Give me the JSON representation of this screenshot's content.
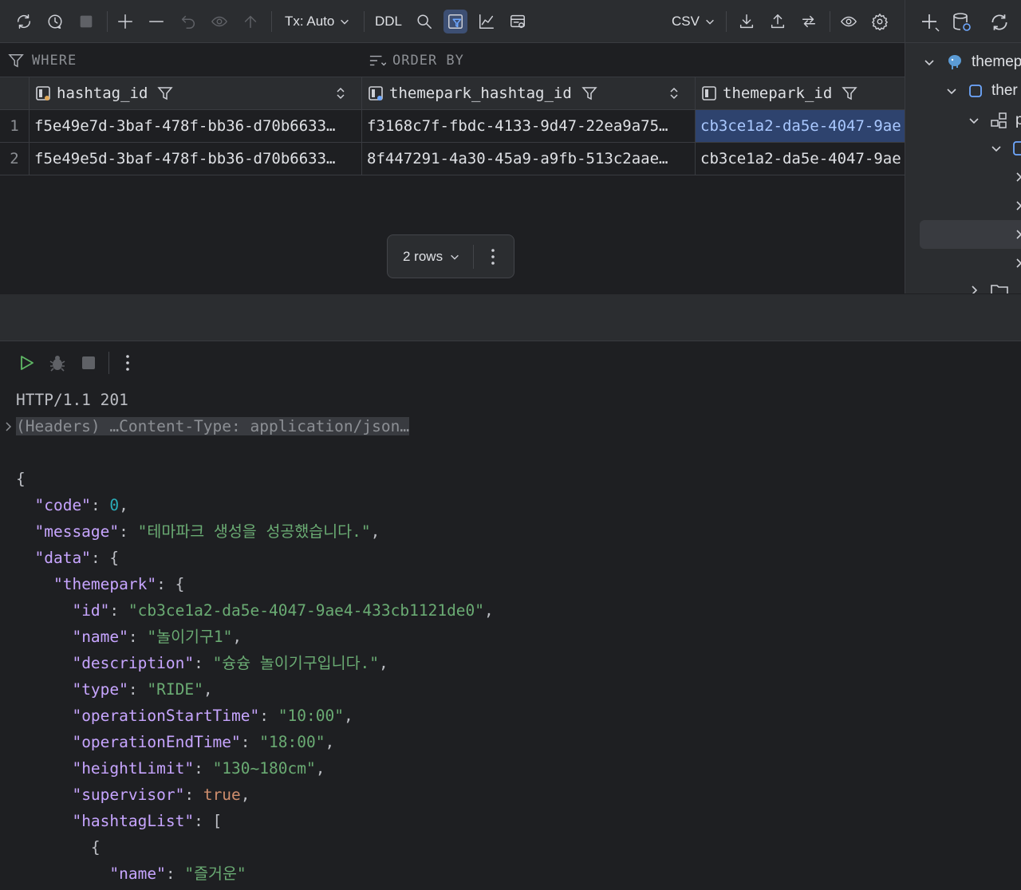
{
  "toolbar": {
    "tx_label": "Tx: Auto",
    "ddl_label": "DDL",
    "format_label": "CSV"
  },
  "filter": {
    "where_label": "WHERE",
    "order_by_label": "ORDER BY"
  },
  "grid": {
    "columns": [
      "hashtag_id",
      "themepark_hashtag_id",
      "themepark_id"
    ],
    "rows": [
      {
        "num": "1",
        "cells": [
          "f5e49e7d-3baf-478f-bb36-d70b6633…",
          "f3168c7f-fbdc-4133-9d47-22ea9a75…",
          "cb3ce1a2-da5e-4047-9ae"
        ]
      },
      {
        "num": "2",
        "cells": [
          "f5e49e5d-3baf-478f-bb36-d70b6633…",
          "8f447291-4a30-45a9-a9fb-513c2aae…",
          "cb3ce1a2-da5e-4047-9ae"
        ]
      }
    ],
    "rows_count_label": "2 rows"
  },
  "tree": {
    "items": [
      "themep",
      "ther",
      "p"
    ]
  },
  "response": {
    "status_line": "HTTP/1.1 201",
    "headers_summary": "(Headers) …Content-Type: application/json…",
    "body": {
      "code": "0",
      "message": "\"테마파크 생성을 성공했습니다.\"",
      "id": "\"cb3ce1a2-da5e-4047-9ae4-433cb1121de0\"",
      "name": "\"놀이기구1\"",
      "description": "\"슝슝 놀이기구입니다.\"",
      "type": "\"RIDE\"",
      "operationStartTime": "\"10:00\"",
      "operationEndTime": "\"18:00\"",
      "heightLimit": "\"130~180cm\"",
      "supervisor": "true",
      "hashtag_name": "\"즐거운\""
    },
    "keys": {
      "code": "\"code\"",
      "message": "\"message\"",
      "data": "\"data\"",
      "themepark": "\"themepark\"",
      "id": "\"id\"",
      "name": "\"name\"",
      "description": "\"description\"",
      "type": "\"type\"",
      "operationStartTime": "\"operationStartTime\"",
      "operationEndTime": "\"operationEndTime\"",
      "heightLimit": "\"heightLimit\"",
      "supervisor": "\"supervisor\"",
      "hashtagList": "\"hashtagList\"",
      "hashtag_name": "\"name\""
    }
  }
}
